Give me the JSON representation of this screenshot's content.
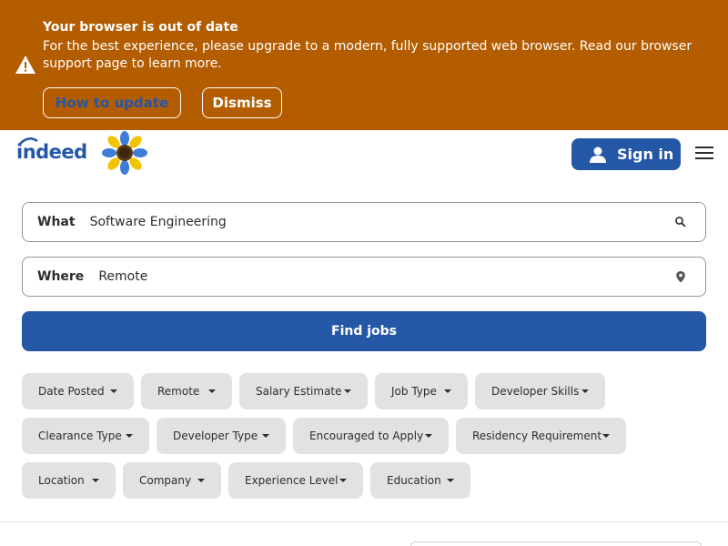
{
  "banner": {
    "title": "Your browser is out of date",
    "message": "For the best experience, please upgrade to a modern, fully supported web browser. Read our browser support page to learn more.",
    "how_to_update": "How to update",
    "dismiss": "Dismiss",
    "background_color": "#b35c00",
    "icon": "warning-icon"
  },
  "header": {
    "logo_text": "indeed",
    "sign_in": "Sign in",
    "brand_color": "#2557a7",
    "icons": [
      "sunflower-icon",
      "person-icon",
      "hamburger-menu-icon"
    ]
  },
  "search": {
    "what_label": "What",
    "what_value": "Software Engineering",
    "where_label": "Where",
    "where_value": "Remote",
    "find_button": "Find jobs",
    "icons": [
      "search-icon",
      "location-pin-icon"
    ]
  },
  "filters": [
    {
      "label": "Date Posted"
    },
    {
      "label": "Remote"
    },
    {
      "label": "Salary Estimate"
    },
    {
      "label": "Job Type"
    },
    {
      "label": "Developer Skills"
    },
    {
      "label": "Clearance Type"
    },
    {
      "label": "Developer Type"
    },
    {
      "label": "Encouraged to Apply"
    },
    {
      "label": "Residency Requirement"
    },
    {
      "label": "Location"
    },
    {
      "label": "Company"
    },
    {
      "label": "Experience Level"
    },
    {
      "label": "Education"
    }
  ]
}
